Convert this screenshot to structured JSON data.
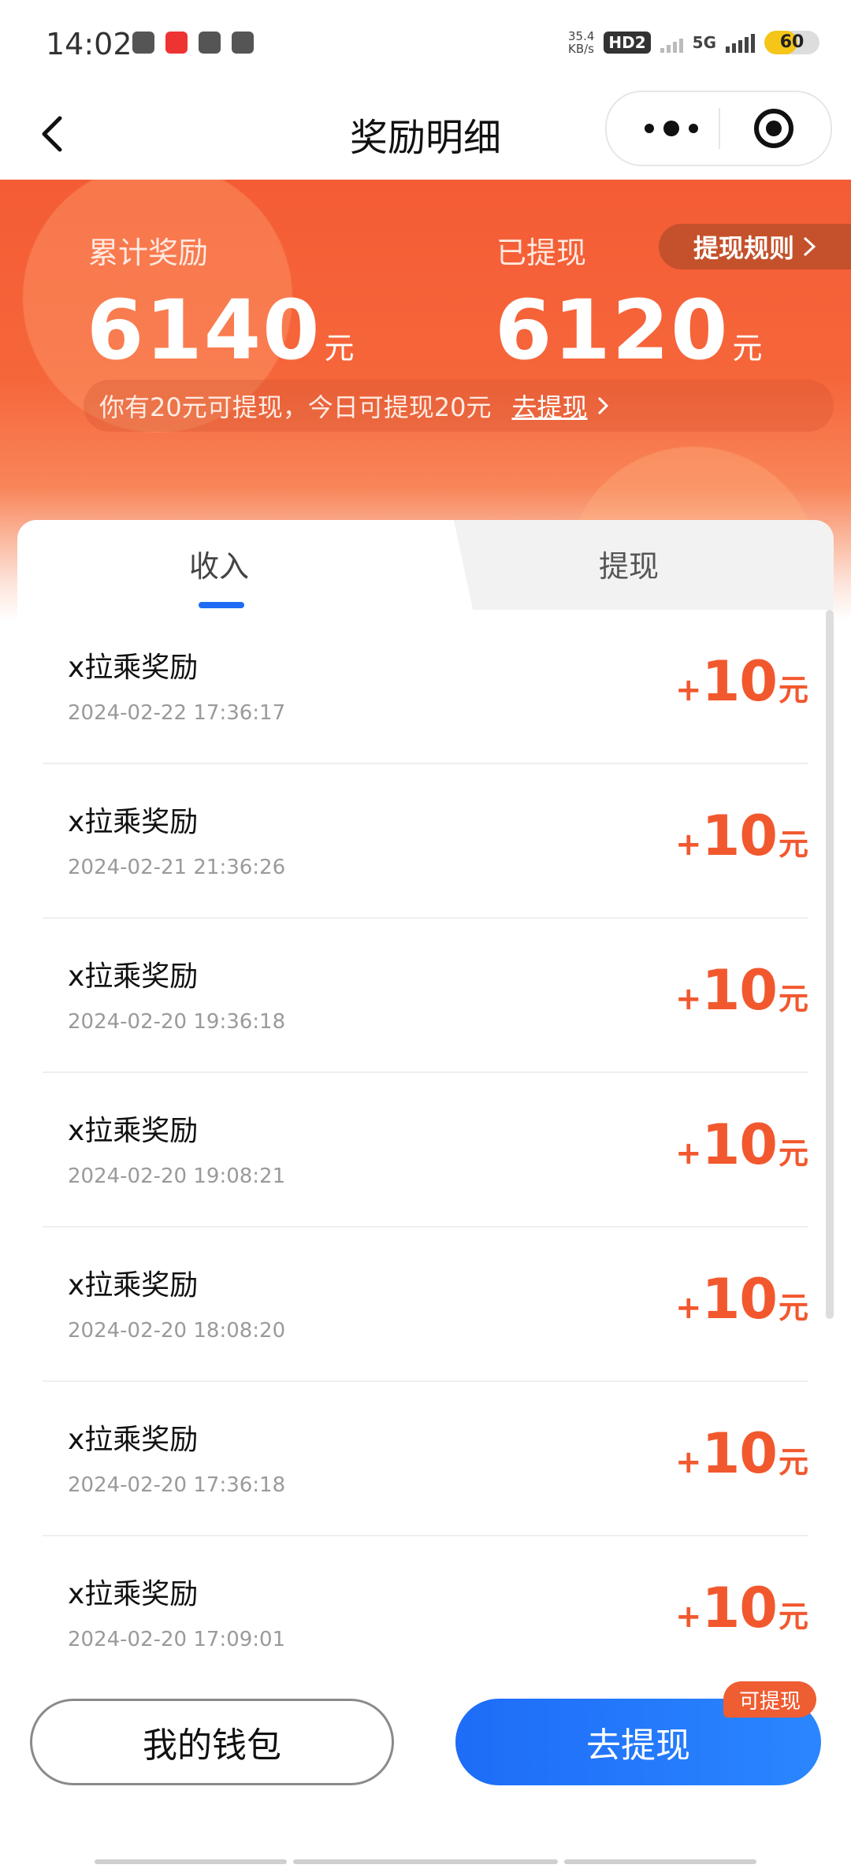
{
  "status_bar": {
    "time": "14:02",
    "speed_value": "35.4",
    "speed_unit": "KB/s",
    "hd_label": "HD2",
    "network": "5G",
    "battery": "60",
    "battery_level_percent": 60
  },
  "header": {
    "title": "奖励明细"
  },
  "summary": {
    "total_label": "累计奖励",
    "total_value": "6140",
    "total_unit": "元",
    "withdrawn_label": "已提现",
    "withdrawn_value": "6120",
    "withdrawn_unit": "元",
    "rules_label": "提现规则",
    "tip_text": "你有20元可提现，今日可提现20元",
    "tip_link": "去提现"
  },
  "tabs": [
    {
      "label": "收入",
      "active": true
    },
    {
      "label": "提现",
      "active": false
    }
  ],
  "records": [
    {
      "title": "x拉乘奖励",
      "time": "2024-02-22 17:36:17",
      "sign": "+",
      "amount": "10",
      "unit": "元"
    },
    {
      "title": "x拉乘奖励",
      "time": "2024-02-21 21:36:26",
      "sign": "+",
      "amount": "10",
      "unit": "元"
    },
    {
      "title": "x拉乘奖励",
      "time": "2024-02-20 19:36:18",
      "sign": "+",
      "amount": "10",
      "unit": "元"
    },
    {
      "title": "x拉乘奖励",
      "time": "2024-02-20 19:08:21",
      "sign": "+",
      "amount": "10",
      "unit": "元"
    },
    {
      "title": "x拉乘奖励",
      "time": "2024-02-20 18:08:20",
      "sign": "+",
      "amount": "10",
      "unit": "元"
    },
    {
      "title": "x拉乘奖励",
      "time": "2024-02-20 17:36:18",
      "sign": "+",
      "amount": "10",
      "unit": "元"
    },
    {
      "title": "x拉乘奖励",
      "time": "2024-02-20 17:09:01",
      "sign": "+",
      "amount": "10",
      "unit": "元"
    }
  ],
  "bottom": {
    "wallet_label": "我的钱包",
    "withdraw_label": "去提现",
    "badge": "可提现"
  },
  "colors": {
    "accent_orange": "#f2582e",
    "primary_blue": "#1e6cf7",
    "banner": "#f45c35"
  }
}
